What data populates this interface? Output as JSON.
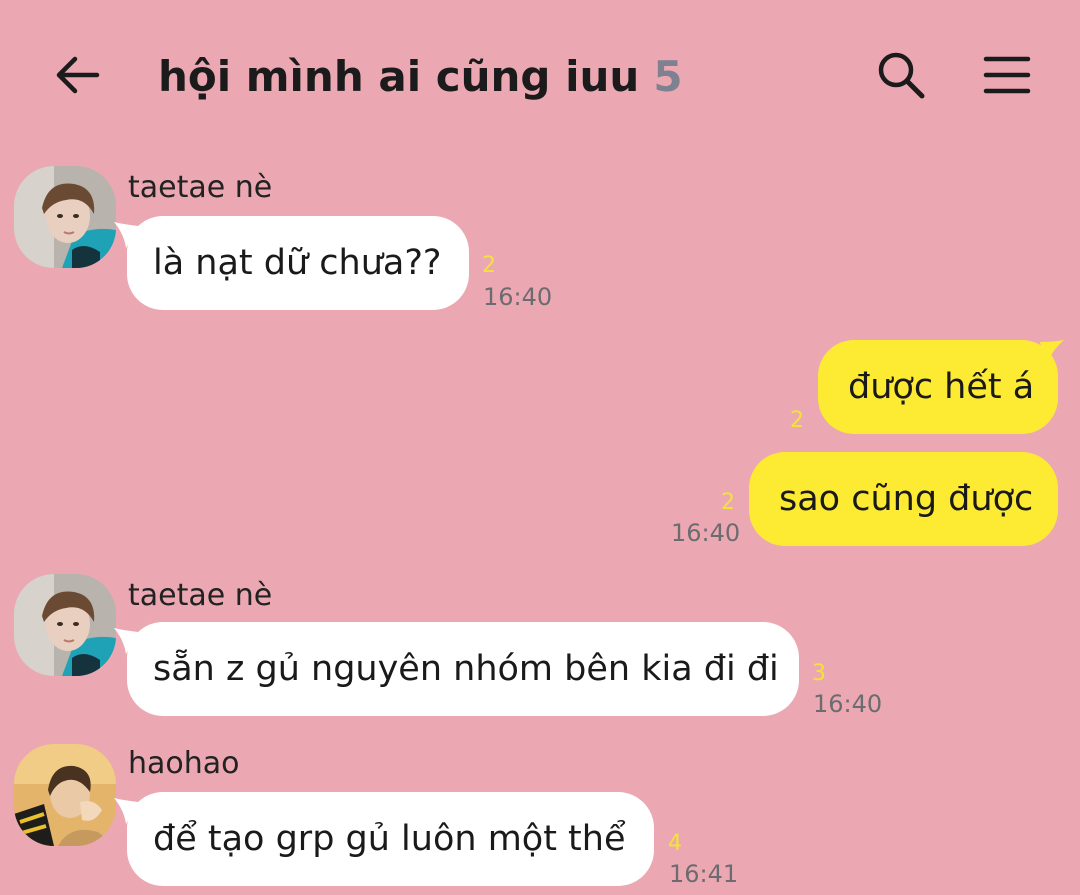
{
  "header": {
    "back_icon": "arrow-left-icon",
    "title": "hội mình ai cũng iuu",
    "member_count": "5",
    "search_icon": "search-icon",
    "menu_icon": "hamburger-menu-icon"
  },
  "messages": [
    {
      "sender": "taetae nè",
      "text": "là nạt dữ chưa??",
      "unread": "2",
      "time": "16:40",
      "direction": "incoming"
    },
    {
      "text": "được hết á",
      "unread": "2",
      "direction": "outgoing"
    },
    {
      "text": "sao cũng được",
      "unread": "2",
      "time": "16:40",
      "direction": "outgoing"
    },
    {
      "sender": "taetae nè",
      "text": "sẵn z gủ nguyên nhóm bên kia đi đi",
      "unread": "3",
      "time": "16:40",
      "direction": "incoming"
    },
    {
      "sender": "haohao",
      "text": "để tạo grp gủ luôn một thể",
      "unread": "4",
      "time": "16:41",
      "direction": "incoming"
    }
  ],
  "colors": {
    "background": "#EBA8B2",
    "incoming_bubble": "#FFFFFF",
    "outgoing_bubble": "#FDEB33",
    "unread_count": "#F3E238",
    "member_count": "#7D8190"
  }
}
